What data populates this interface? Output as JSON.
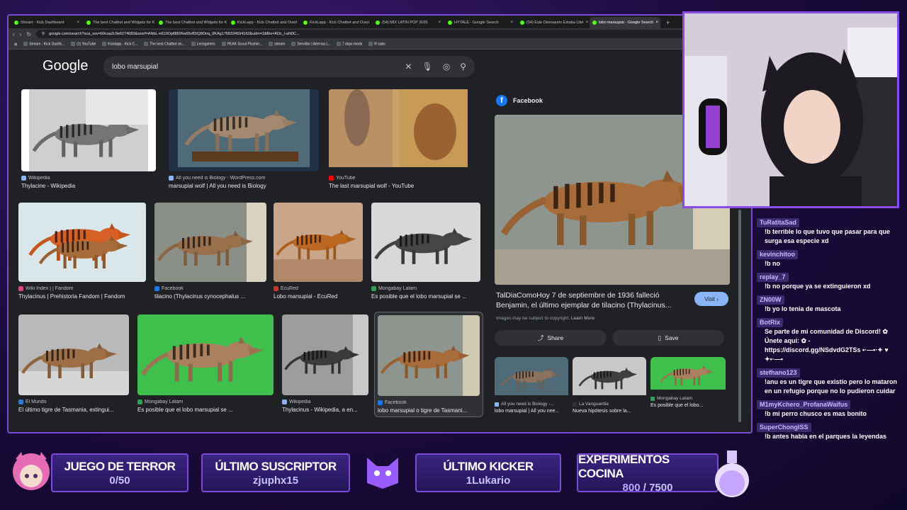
{
  "browser": {
    "tabs": [
      {
        "label": "Stream - Kick Dashboard",
        "active": false
      },
      {
        "label": "The best Chatbot and Widgets for K",
        "active": false
      },
      {
        "label": "The best Chatbot and Widgets for K",
        "active": false
      },
      {
        "label": "KickLapp - Kick Chatbot and Overl",
        "active": false
      },
      {
        "label": "KickLapp - Kick Chatbot and Overl",
        "active": false
      },
      {
        "label": "(54) MIX LATIN POP 2025",
        "active": false
      },
      {
        "label": "HYTALE - Google Search",
        "active": false
      },
      {
        "label": "(54) Este Dinosaurio Estaba Lller",
        "active": false
      },
      {
        "label": "lobo marsupial - Google Search",
        "active": true
      }
    ],
    "url": "google.com/search?sca_esv=b9caa2c9e6274683&sxsrf=ANbL-n619Opl880Rw65vff2iQ8Onq_0KAg1768334594162&udm=2&fbs=ADc_l-aN0C...",
    "bookmarks": [
      "Stream - Kick Dashb...",
      "(1) YouTube",
      "Kicklapp - Kick C...",
      "The best Chatbot an...",
      "Leosgames",
      "PEAK Scout Plushie...",
      "stream",
      "Servidor | Aternos |...",
      "7 days mods",
      "R subs"
    ]
  },
  "google": {
    "logo": "Google",
    "query": "lobo marsupial"
  },
  "results": [
    {
      "source": "Wikipedia",
      "caption": "Thylacine - Wikipedia"
    },
    {
      "source": "All you need is Biology - WordPress.com",
      "caption": "marsupial wolf | All you need is Biology"
    },
    {
      "source": "YouTube",
      "caption": "The last marsupial wolf - YouTube"
    },
    {
      "source": "Wiki Index | | Fandom",
      "caption": "Thylacinus | Prehistoria Fandom | Fandom"
    },
    {
      "source": "Facebook",
      "caption": "tilacino (Thylacinus cynocephalus ..."
    },
    {
      "source": "EcuRed",
      "caption": "Lobo marsupial - EcuRed"
    },
    {
      "source": "Mongabay Latam",
      "caption": "Es posible que el lobo marsupial se ..."
    },
    {
      "source": "El Mundo",
      "caption": "El último tigre de Tasmania, extingui..."
    },
    {
      "source": "Mongabay Latam",
      "caption": "Es posible que el lobo marsupial se ..."
    },
    {
      "source": "Wikipedia",
      "caption": "Thylacinus - Wikipedia, a en..."
    },
    {
      "source": "Facebook",
      "caption": "lobo marsupial o tigre de Tasmani..."
    }
  ],
  "panel": {
    "source": "Facebook",
    "title": "TalDiaComoHoy 7 de septiembre de 1936 falleció Benjamin, el último ejemplar de tilacino (Thylacinus...",
    "visit": "Visit",
    "copyright": "Images may be subject to copyright.",
    "learn_more": "Learn More",
    "share": "Share",
    "save": "Save",
    "related": [
      {
        "source": "All you need is Biology -...",
        "caption": "lobo marsupial | All you nee..."
      },
      {
        "source": "La Vanguardia",
        "caption": "Nueva hipótesis sobre la..."
      },
      {
        "source": "Mongabay Latam",
        "caption": "Es posible que el lobo..."
      }
    ]
  },
  "chat": [
    {
      "user": "TuRatitaSad",
      "text": "!b terrible lo que tuvo que pasar para que surga esa especie xd"
    },
    {
      "user": "kevinchitoo",
      "text": "!b no"
    },
    {
      "user": "replay_7",
      "text": "!b no porque ya se extinguieron xd"
    },
    {
      "user": "ZN00W",
      "text": "!b yo lo tenia de mascota"
    },
    {
      "user": "BotRix",
      "text": "Se parte de mi comunidad de Discord! ✿ Únete aquí: ✿ - https://discord.gg/NSdvdG2TSs •·—•·✦ ♥ ✦•·—•"
    },
    {
      "user": "stefhano123",
      "text": "!anu es un tigre que existío pero lo mataron en un refugio porque no lo pudieron cuidar"
    },
    {
      "user": "M1myKchero_ProfanaWaifus",
      "text": "!b mi perro chusco es mas bonito"
    },
    {
      "user": "SuperChongISS",
      "text": "!b antes habia en el parques la leyendas"
    }
  ],
  "overlay": {
    "game_title": "JUEGO DE TERROR",
    "game_value": "0/50",
    "sub_title": "ÚLTIMO SUSCRIPTOR",
    "sub_value": "zjuphx15",
    "kicker_title": "ÚLTIMO KICKER",
    "kicker_value": "1Lukario",
    "exp_title": "EXPERIMENTOS COCINA",
    "exp_current": "800",
    "exp_goal": "/ 7500"
  },
  "colors": {
    "accent": "#7b4bd6",
    "kick_green": "#53fc18",
    "google_blue": "#8ab4f8"
  }
}
